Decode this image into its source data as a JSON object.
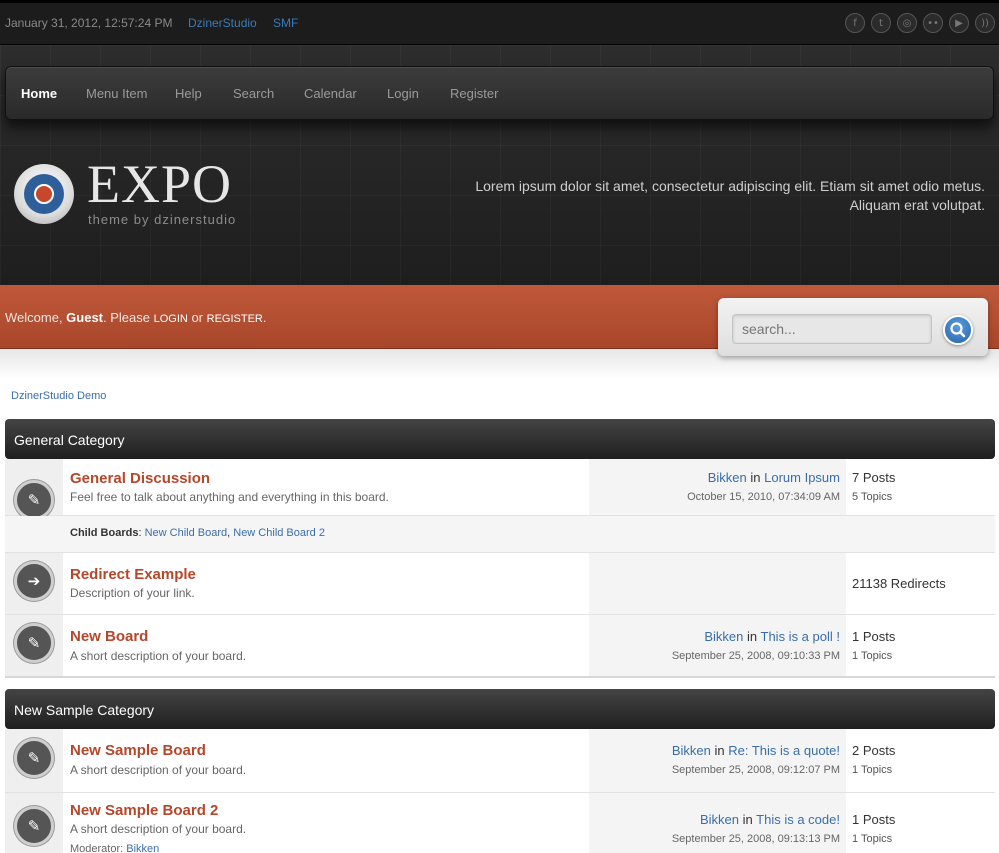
{
  "topbar": {
    "datetime": "January 31, 2012, 12:57:24 PM",
    "links": [
      "DzinerStudio",
      "SMF"
    ],
    "social_icons": [
      "facebook-icon",
      "twitter-icon",
      "dribbble-icon",
      "flickr-icon",
      "youtube-icon",
      "rss-icon"
    ]
  },
  "nav": {
    "items": [
      "Home",
      "Menu Item",
      "Help",
      "Search",
      "Calendar",
      "Login",
      "Register"
    ],
    "active": "Home"
  },
  "logo": {
    "text": "EXPO",
    "subtitle": "theme by dzinerstudio"
  },
  "tagline": "Lorem ipsum dolor sit amet, consectetur adipiscing elit. Etiam sit amet odio metus. Aliquam erat volutpat.",
  "welcome": {
    "prefix": "Welcome, ",
    "user": "Guest",
    "middle": ". Please ",
    "login": "LOGIN",
    "or": " or ",
    "register": "REGISTER",
    "suffix": "."
  },
  "search": {
    "placeholder": "search..."
  },
  "breadcrumb": "DzinerStudio Demo",
  "categories": [
    {
      "title": "General Category",
      "boards": [
        {
          "name": "General Discussion",
          "description": "Feel free to talk about anything and everything in this board.",
          "last_user": "Bikken",
          "in": "in",
          "last_topic": "Lorum Ipsum",
          "last_date": "October 15, 2010, 07:34:09 AM",
          "stat1": "7 Posts",
          "stat2": "5 Topics",
          "child_label": "Child Boards",
          "child_boards": [
            "New Child Board",
            "New Child Board 2"
          ]
        },
        {
          "name": "Redirect Example",
          "description": "Description of your link.",
          "stat1": "21138 Redirects"
        },
        {
          "name": "New Board",
          "description": "A short description of your board.",
          "last_user": "Bikken",
          "in": "in",
          "last_topic": "This is a poll !",
          "last_date": "September 25, 2008, 09:10:33 PM",
          "stat1": "1 Posts",
          "stat2": "1 Topics"
        }
      ]
    },
    {
      "title": "New Sample Category",
      "boards": [
        {
          "name": "New Sample Board",
          "description": "A short description of your board.",
          "last_user": "Bikken",
          "in": "in",
          "last_topic": "Re: This is a quote!",
          "last_date": "September 25, 2008, 09:12:07 PM",
          "stat1": "2 Posts",
          "stat2": "1 Topics"
        },
        {
          "name": "New Sample Board 2",
          "description": "A short description of your board.",
          "last_user": "Bikken",
          "in": "in",
          "last_topic": "This is a code!",
          "last_date": "September 25, 2008, 09:13:13 PM",
          "stat1": "1 Posts",
          "stat2": "1 Topics",
          "moderator_label": "Moderator:",
          "moderator": "Bikken"
        }
      ]
    }
  ]
}
